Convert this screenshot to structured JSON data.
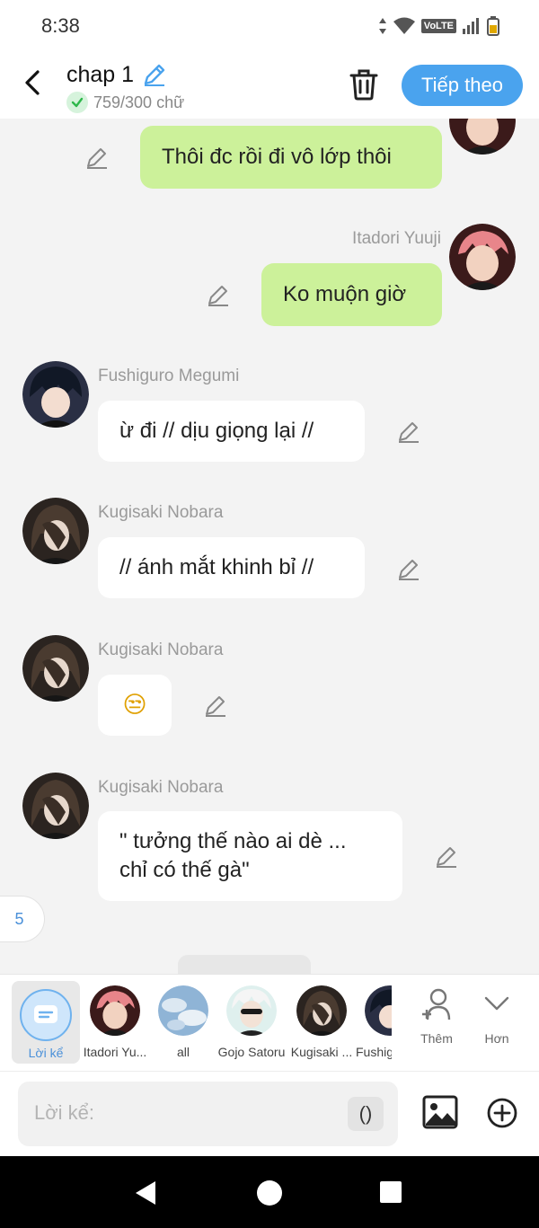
{
  "status": {
    "time": "8:38",
    "volte": "VoLTE"
  },
  "header": {
    "title": "chap 1",
    "word_count": "759/300 chữ",
    "next_label": "Tiếp theo"
  },
  "messages": [
    {
      "text": "Thôi đc rồi đi vô lớp thôi"
    },
    {
      "name": "Itadori Yuuji",
      "text": "Ko muộn giờ"
    },
    {
      "name": "Fushiguro Megumi",
      "text": "ừ đi // dịu giọng lại //"
    },
    {
      "name": "Kugisaki Nobara",
      "text": "// ánh mắt khinh bỉ //"
    },
    {
      "name": "Kugisaki Nobara",
      "text": "😒"
    },
    {
      "name": "Kugisaki Nobara",
      "line1": "\" tưởng thế nào ai dè ...",
      "line2": "chỉ có thế gà\""
    }
  ],
  "page_badge": "5",
  "character_bar": {
    "narrator": "Lời kể",
    "characters": [
      "Itadori Yu...",
      "all",
      "Gojo Satoru",
      "Kugisaki ...",
      "Fushig"
    ],
    "more_label": "Thêm",
    "expand_label": "Hơn"
  },
  "input": {
    "placeholder": "Lời kể:",
    "paren_label": "()"
  },
  "colors": {
    "accent": "#4aa3ee",
    "bubble_green": "#ccf19a",
    "background": "#f3f3f3"
  }
}
